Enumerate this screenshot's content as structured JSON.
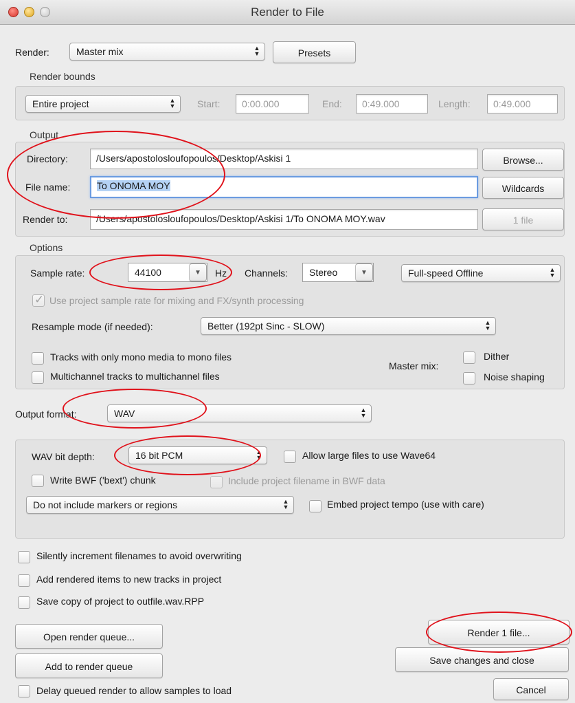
{
  "window": {
    "title": "Render to File"
  },
  "render": {
    "label": "Render:",
    "source_value": "Master mix",
    "presets_label": "Presets"
  },
  "bounds": {
    "heading": "Render bounds",
    "mode_value": "Entire project",
    "start_label": "Start:",
    "start_value": "0:00.000",
    "end_label": "End:",
    "end_value": "0:49.000",
    "length_label": "Length:",
    "length_value": "0:49.000"
  },
  "output": {
    "heading": "Output",
    "directory_label": "Directory:",
    "directory_value": "/Users/apostolosloufopoulos/Desktop/Askisi 1",
    "browse_label": "Browse...",
    "filename_label": "File name:",
    "filename_value": "To ONOMA MOY",
    "wildcards_label": "Wildcards",
    "render_to_label": "Render to:",
    "render_to_value": "/Users/apostolosloufopoulos/Desktop/Askisi 1/To ONOMA MOY.wav",
    "file_count_label": "1 file"
  },
  "options": {
    "heading": "Options",
    "sample_rate_label": "Sample rate:",
    "sample_rate_value": "44100",
    "hz_label": "Hz",
    "channels_label": "Channels:",
    "channels_value": "Stereo",
    "speed_value": "Full-speed Offline",
    "use_project_rate_label": "Use project sample rate for mixing and FX/synth processing",
    "resample_label": "Resample mode (if needed):",
    "resample_value": "Better (192pt Sinc - SLOW)",
    "mono_label": "Tracks with only mono media to mono files",
    "multichannel_label": "Multichannel tracks to multichannel files",
    "master_mix_label": "Master mix:",
    "dither_label": "Dither",
    "noise_shaping_label": "Noise shaping"
  },
  "format": {
    "label": "Output format:",
    "value": "WAV"
  },
  "wav": {
    "bit_depth_label": "WAV bit depth:",
    "bit_depth_value": "16 bit PCM",
    "wave64_label": "Allow large files to use Wave64",
    "bwf_label": "Write BWF ('bext') chunk",
    "bwf_filename_label": "Include project filename in BWF data",
    "markers_value": "Do not include markers or regions",
    "tempo_label": "Embed project tempo (use with care)"
  },
  "misc": {
    "increment_label": "Silently increment filenames to avoid overwriting",
    "add_tracks_label": "Add rendered items to new tracks in project",
    "save_copy_label": "Save copy of project to outfile.wav.RPP",
    "delay_label": "Delay queued render to allow samples to load"
  },
  "buttons": {
    "open_queue": "Open render queue...",
    "add_queue": "Add to render queue",
    "render": "Render 1 file...",
    "save_close": "Save changes and close",
    "cancel": "Cancel"
  },
  "colors": {
    "annotation_ellipse": "#e0121b",
    "window_bg": "#ececec",
    "focus_ring": "#6a9be0"
  }
}
